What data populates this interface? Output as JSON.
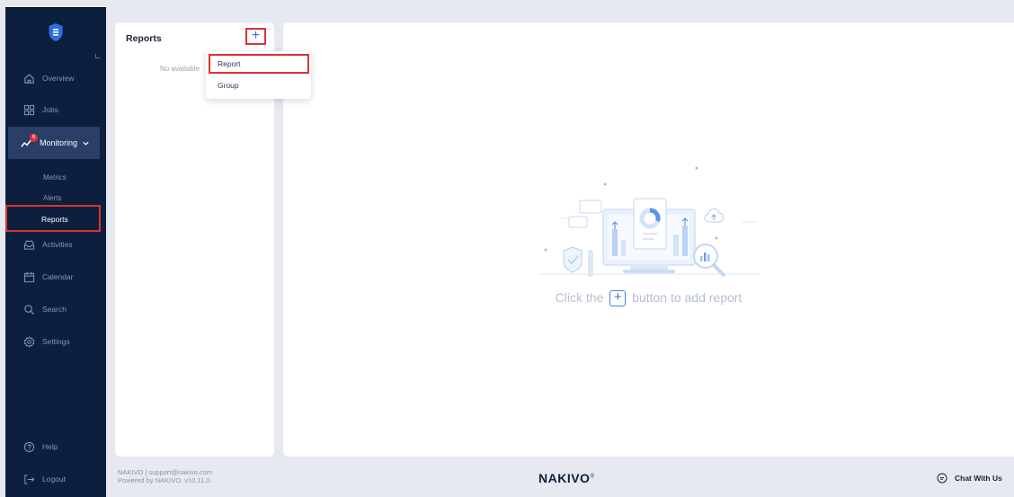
{
  "sidebar": {
    "items": {
      "overview": "Overview",
      "jobs": "Jobs",
      "monitoring": "Monitoring",
      "activities": "Activities",
      "calendar": "Calendar",
      "search": "Search",
      "settings": "Settings",
      "help": "Help",
      "logout": "Logout"
    },
    "monitoring_badge": "6",
    "monitoring_sub": {
      "metrics": "Metrics",
      "alerts": "Alerts",
      "reports": "Reports"
    }
  },
  "reports_panel": {
    "title": "Reports",
    "add_symbol": "+",
    "empty_text": "No available"
  },
  "add_menu": {
    "report": "Report",
    "group": "Group"
  },
  "main": {
    "empty_prefix": "Click the",
    "empty_plus": "+",
    "empty_suffix": "button to add report"
  },
  "footer": {
    "line1": "NAKIVO | support@nakivo.com",
    "line2": "Powered by NAKIVO. v10.11.0.",
    "logo": "NAKIVO",
    "logo_mark": "®",
    "chat": "Chat With Us"
  },
  "colors": {
    "sidebar_bg": "#0c1f3f",
    "highlight": "#e0302d",
    "accent": "#3a6fd8",
    "badge": "#e0303a"
  }
}
